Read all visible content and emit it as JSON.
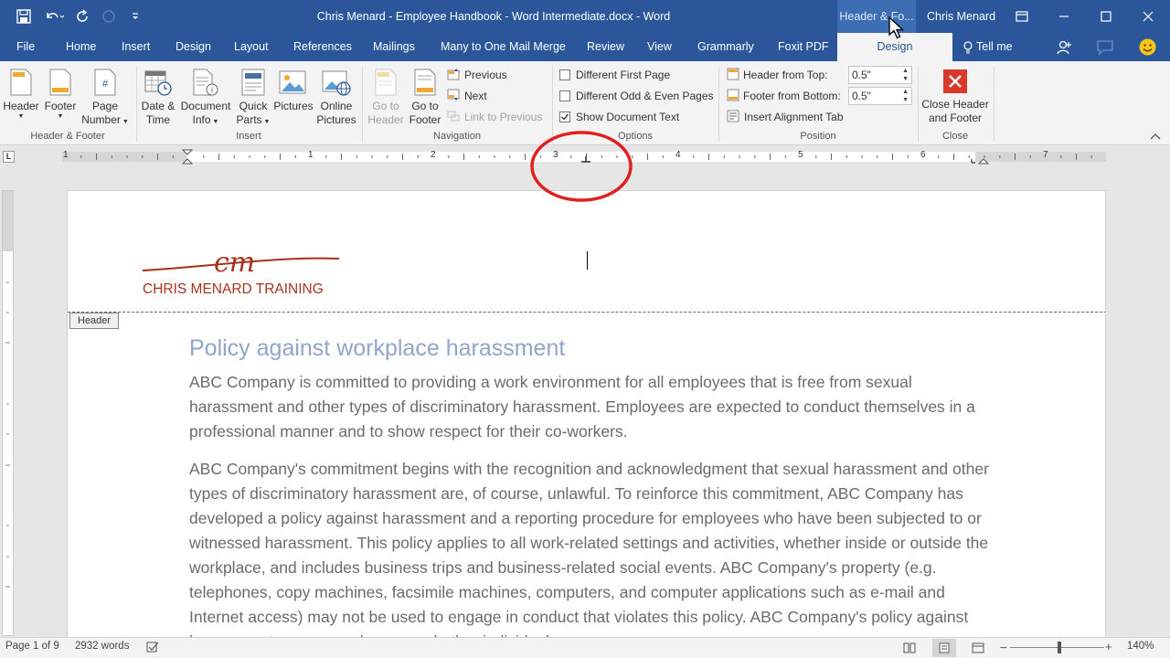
{
  "window": {
    "title": "Chris Menard - Employee Handbook - Word Intermediate.docx - Word",
    "context_tab": "Header & Fo...",
    "user": "Chris Menard"
  },
  "tabs": [
    "File",
    "Home",
    "Insert",
    "Design",
    "Layout",
    "References",
    "Mailings",
    "Many to One Mail Merge",
    "Review",
    "View",
    "Grammarly",
    "Foxit PDF",
    "Design"
  ],
  "tellme": "Tell me",
  "ribbon": {
    "header_btn": "Header",
    "footer_btn": "Footer",
    "page_number_btn": [
      "Page",
      "Number"
    ],
    "group_header_footer": "Header & Footer",
    "date_time_btn": [
      "Date &",
      "Time"
    ],
    "document_info_btn": [
      "Document",
      "Info"
    ],
    "quick_parts_btn": [
      "Quick",
      "Parts"
    ],
    "pictures_btn": "Pictures",
    "online_pictures_btn": [
      "Online",
      "Pictures"
    ],
    "group_insert": "Insert",
    "go_to_header_btn": [
      "Go to",
      "Header"
    ],
    "go_to_footer_btn": [
      "Go to",
      "Footer"
    ],
    "previous": "Previous",
    "next": "Next",
    "link_to_previous": "Link to Previous",
    "group_navigation": "Navigation",
    "different_first_page": "Different First Page",
    "different_odd_even": "Different Odd & Even Pages",
    "show_document_text": "Show Document Text",
    "group_options": "Options",
    "header_from_top_label": "Header from Top:",
    "header_from_top_value": "0.5\"",
    "footer_from_bottom_label": "Footer from Bottom:",
    "footer_from_bottom_value": "0.5\"",
    "insert_alignment_tab": "Insert Alignment Tab",
    "group_position": "Position",
    "close_header_footer_btn": [
      "Close Header",
      "and Footer"
    ],
    "group_close": "Close"
  },
  "ruler": {
    "tab_marker": "L",
    "numbers": [
      "1",
      "1",
      "2",
      "3",
      "4",
      "5",
      "6",
      "7"
    ]
  },
  "document": {
    "logo_script": "cm",
    "logo_text": "CHRIS MENARD TRAINING",
    "header_tag": "Header",
    "heading": "Policy against workplace harassment",
    "para1": "ABC Company is committed to providing a work environment for all employees that is free from sexual harassment and other types of discriminatory harassment. Employees are expected to conduct themselves in a professional manner and to show respect for their co-workers.",
    "para2": "ABC Company's commitment begins with the recognition and acknowledgment that sexual harassment and other types of discriminatory harassment are, of course, unlawful. To reinforce this commitment, ABC Company has developed a policy against harassment and a reporting procedure for employees who have been subjected to or witnessed harassment. This policy applies to all work-related settings and activities, whether inside or outside the workplace, and includes business trips and business-related social events. ABC Company's property (e.g. telephones, copy machines, facsimile machines, computers, and computer applications such as e-mail and Internet access) may not be used to engage in conduct that violates this policy. ABC Company's policy against harassment covers employees and other individuals"
  },
  "status": {
    "page": "Page 1 of 9",
    "words": "2932 words",
    "zoom": "140%"
  },
  "colors": {
    "word_blue": "#2b579a",
    "annotation_red": "#e02020",
    "heading_blue": "#8ea6c9",
    "logo_red": "#a83220",
    "close_red": "#d9392b"
  }
}
